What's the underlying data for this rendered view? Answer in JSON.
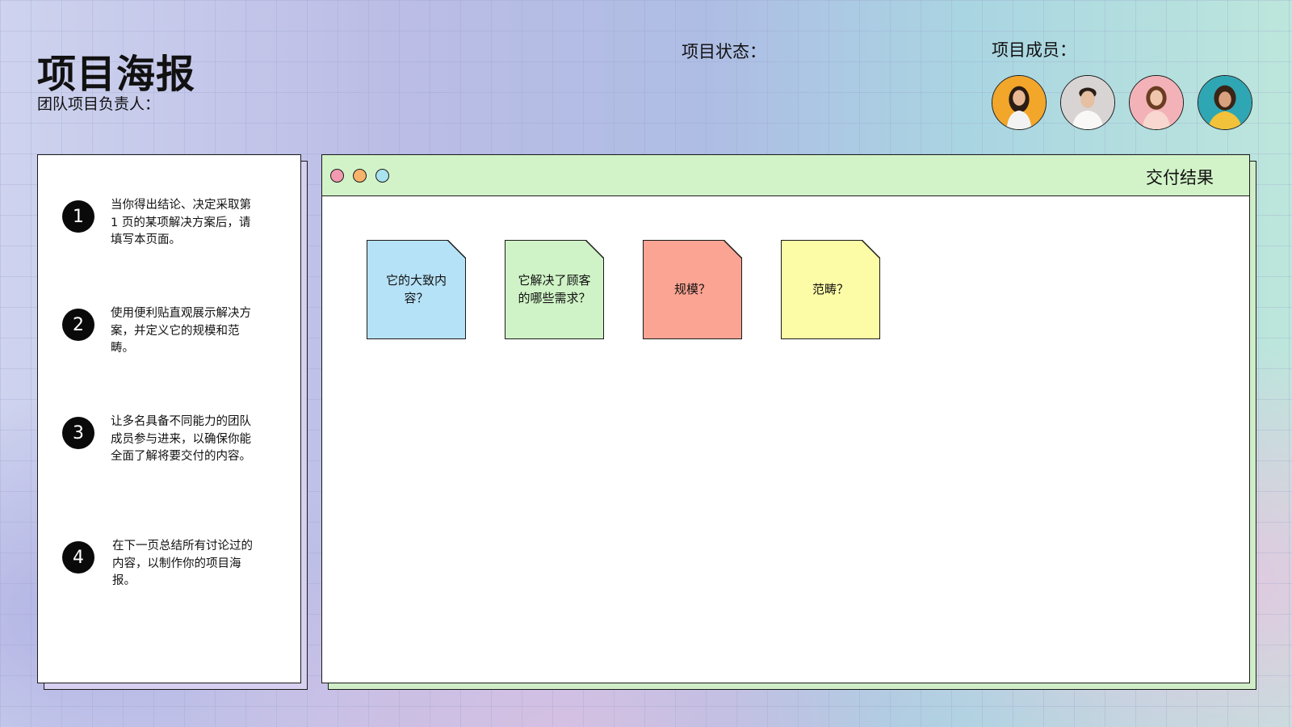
{
  "header": {
    "title": "项目海报",
    "lead_label": "团队项目负责人：",
    "status_label": "项目状态：",
    "members_label": "项目成员："
  },
  "members": [
    {
      "name": "member-1",
      "bg": "#f2a62a"
    },
    {
      "name": "member-2",
      "bg": "#d9d4d4"
    },
    {
      "name": "member-3",
      "bg": "#f3b2b8"
    },
    {
      "name": "member-4",
      "bg": "#2fa6b3"
    }
  ],
  "steps": [
    {
      "number": "1",
      "text": "当你得出结论、决定采取第 1 页的某项解决方案后，请填写本页面。"
    },
    {
      "number": "2",
      "text": "使用便利贴直观展示解决方案，并定义它的规模和范畴。"
    },
    {
      "number": "3",
      "text": "让多名具备不同能力的团队成员参与进来，以确保你能全面了解将要交付的内容。"
    },
    {
      "number": "4",
      "text": "在下一页总结所有讨论过的内容，以制作你的项目海报。"
    }
  ],
  "window": {
    "title": "交付结果",
    "dot_colors": [
      "#f39ab1",
      "#f7b36a",
      "#a9e3ef"
    ]
  },
  "notes": [
    {
      "text": "它的大致内容？",
      "color": "#b6e2f7"
    },
    {
      "text": "它解决了顾客的哪些需求？",
      "color": "#cff3c6"
    },
    {
      "text": "规模？",
      "color": "#fca493"
    },
    {
      "text": "范畴？",
      "color": "#fdfca6"
    }
  ]
}
